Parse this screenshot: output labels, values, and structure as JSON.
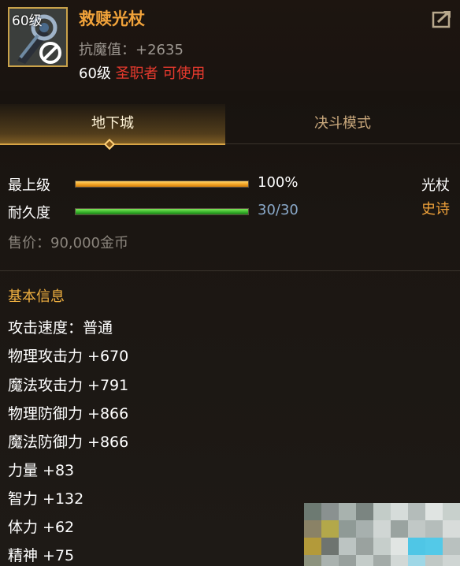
{
  "item": {
    "level_badge": "60级",
    "name": "救赎光杖",
    "resist_label": "抗魔值：",
    "resist_value": "+2635",
    "req_level": "60级",
    "req_class": "圣职者",
    "req_usable": "可使用"
  },
  "tabs": [
    {
      "label": "地下城",
      "active": true
    },
    {
      "label": "决斗模式",
      "active": false
    }
  ],
  "bars": {
    "upgrade_label": "最上级",
    "upgrade_value_text": "100%",
    "upgrade_fraction": 1.0,
    "durability_label": "耐久度",
    "durability_value_text": "30/30",
    "durability_fraction": 1.0
  },
  "weapon_type": "光杖",
  "rarity": "史诗",
  "price": "售价：90,000金币",
  "section_title": "基本信息",
  "stats": [
    "攻击速度：普通",
    "物理攻击力 +670",
    "魔法攻击力 +791",
    "物理防御力 +866",
    "魔法防御力 +866",
    "力量 +83",
    "智力 +132",
    "体力 +62",
    "精神 +75"
  ],
  "colors": {
    "title": "#f0a23a",
    "rarity": "#f0a23a",
    "requirement_red": "#e83a2e",
    "durability_value": "#8aa9c9",
    "section": "#f0b040"
  },
  "icons": [
    "share-icon",
    "forbidden-icon",
    "staff-icon"
  ]
}
